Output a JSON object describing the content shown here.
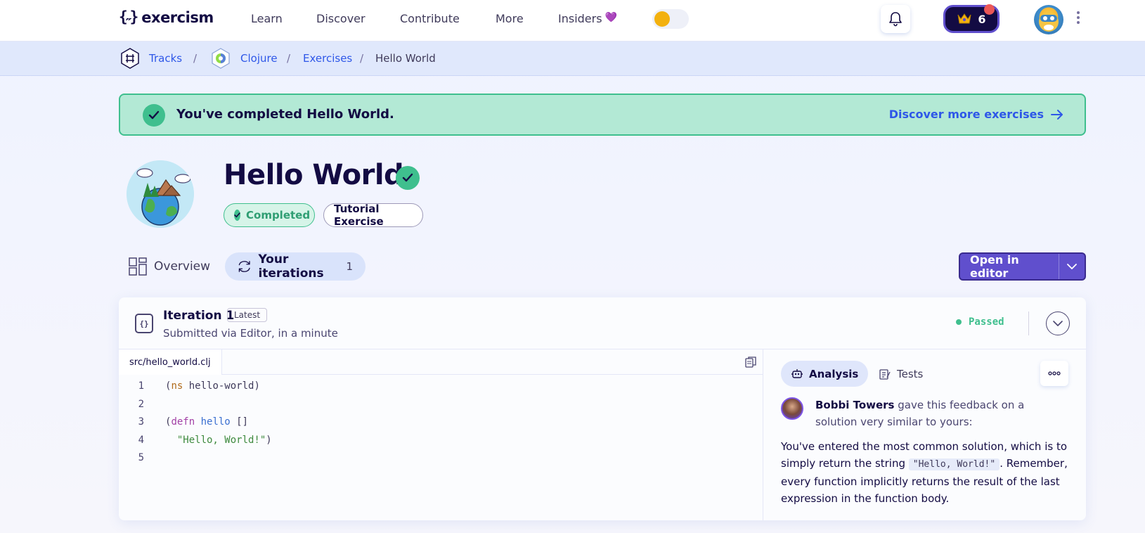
{
  "nav": {
    "logo_mark": "{˶}",
    "logo_text": "exercism",
    "links": [
      "Learn",
      "Discover",
      "Contribute",
      "More",
      "Insiders"
    ],
    "insiders_heart": "💜",
    "reputation": "6"
  },
  "breadcrumb": {
    "tracks": "Tracks",
    "track": "Clojure",
    "exercises": "Exercises",
    "current": "Hello World",
    "separator": "/"
  },
  "banner": {
    "message": "You've completed Hello World.",
    "link": "Discover more exercises"
  },
  "exercise": {
    "title": "Hello World",
    "tags": [
      "Completed",
      "Tutorial Exercise"
    ]
  },
  "tabs": {
    "overview": "Overview",
    "iterations": "Your iterations",
    "iterations_count": "1"
  },
  "editor_button": "Open in editor",
  "iteration": {
    "title": "Iteration 1",
    "badge": "Latest",
    "subtitle": "Submitted via Editor, in a minute",
    "status": "Passed",
    "file": "src/hello_world.clj",
    "line_numbers": [
      "1",
      "2",
      "3",
      "4",
      "5"
    ],
    "code": {
      "l1_open": "(",
      "l1_kw": "ns",
      "l1_rest": " hello-world)",
      "l3_open": "(",
      "l3_kw": "defn",
      "l3_sp": " ",
      "l3_fn": "hello",
      "l3_rest": " []",
      "l4_indent": "  ",
      "l4_str": "\"Hello, World!\"",
      "l4_close": ")"
    }
  },
  "side": {
    "tab_analysis": "Analysis",
    "tab_tests": "Tests",
    "mentor_name": "Bobbi Towers",
    "mentor_text": " gave this feedback on a solution very similar to yours:",
    "feedback_1": "You've entered the most common solution, which is to simply return the string ",
    "feedback_code": "\"Hello, World!\"",
    "feedback_2": ". Remember, every function implicitly returns the result of the last expression in the function body."
  },
  "colors": {
    "accent": "#604fcd",
    "success": "#3fbf8e",
    "link": "#2e57e8",
    "text_dark": "#130b43"
  }
}
